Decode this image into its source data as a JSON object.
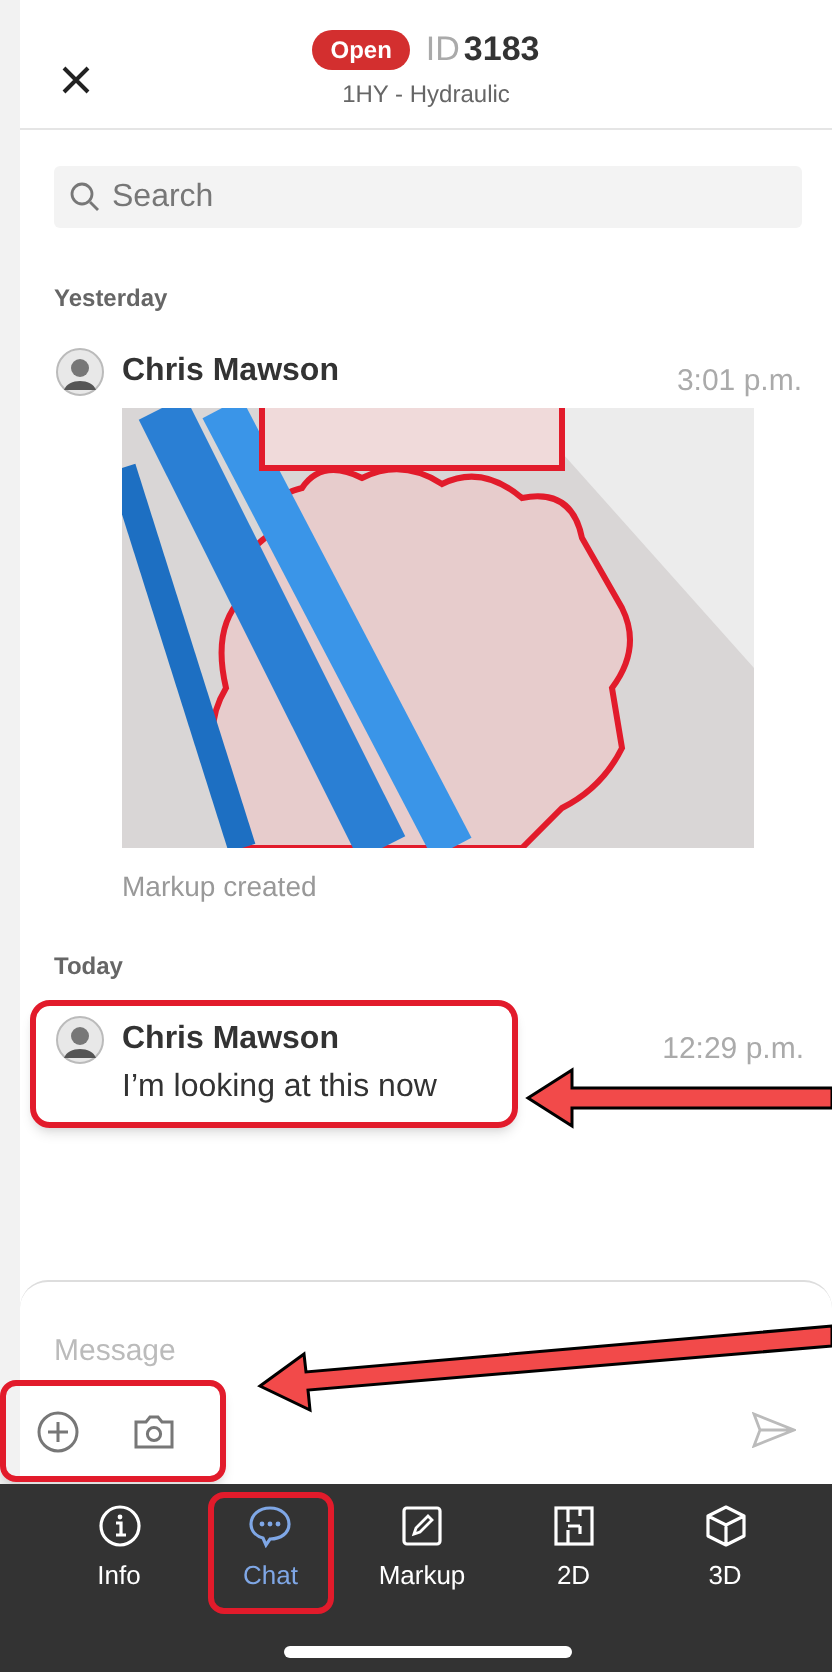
{
  "header": {
    "status": "Open",
    "id_label": "ID",
    "id_number": "3183",
    "subtitle": "1HY - Hydraulic"
  },
  "search": {
    "placeholder": "Search"
  },
  "groups": [
    {
      "day": "Yesterday",
      "messages": [
        {
          "kind": "image",
          "author": "Chris Mawson",
          "time": "3:01 p.m.",
          "caption": "Markup created",
          "highlighted": false
        }
      ]
    },
    {
      "day": "Today",
      "messages": [
        {
          "kind": "text",
          "author": "Chris Mawson",
          "time": "12:29 p.m.",
          "text": "I’m looking at this now",
          "highlighted": true
        }
      ]
    }
  ],
  "composer": {
    "placeholder": "Message",
    "tools_highlighted": true
  },
  "tabs": [
    {
      "label": "Info",
      "kind": "info",
      "selected": false,
      "highlighted": false
    },
    {
      "label": "Chat",
      "kind": "chat",
      "selected": true,
      "highlighted": true
    },
    {
      "label": "Markup",
      "kind": "markup",
      "selected": false,
      "highlighted": false
    },
    {
      "label": "2D",
      "kind": "plan",
      "selected": false,
      "highlighted": false
    },
    {
      "label": "3D",
      "kind": "cube",
      "selected": false,
      "highlighted": false
    }
  ]
}
